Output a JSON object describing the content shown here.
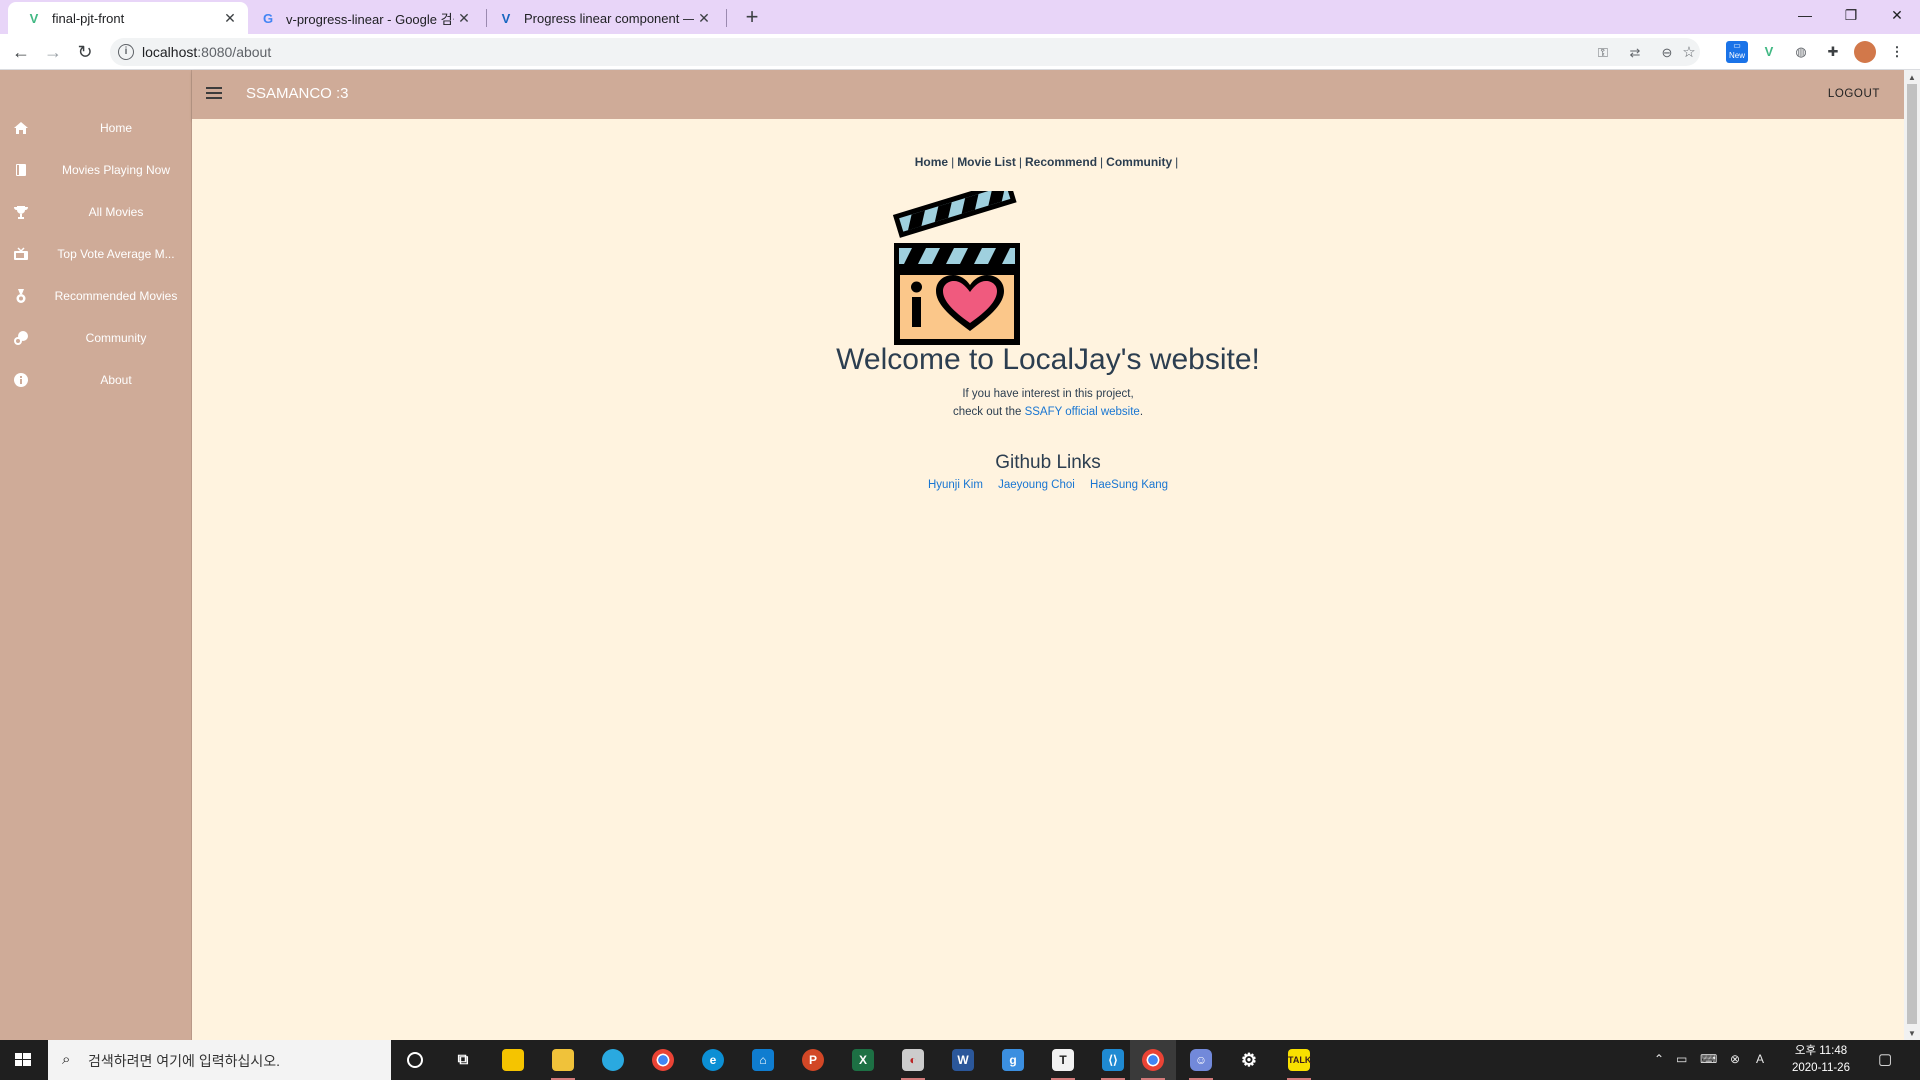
{
  "browser": {
    "tabs": [
      {
        "title": "final-pjt-front",
        "active": true
      },
      {
        "title": "v-progress-linear - Google 검색",
        "active": false
      },
      {
        "title": "Progress linear component — V",
        "active": false
      }
    ],
    "url_host": "localhost",
    "url_path": ":8080/about",
    "new_badge": "New"
  },
  "sidebar": {
    "items": [
      {
        "label": "Home",
        "icon": "home-icon"
      },
      {
        "label": "Movies Playing Now",
        "icon": "book-icon"
      },
      {
        "label": "All Movies",
        "icon": "trophy-icon"
      },
      {
        "label": "Top Vote Average M...",
        "icon": "tv-icon"
      },
      {
        "label": "Recommended Movies",
        "icon": "medal-icon"
      },
      {
        "label": "Community",
        "icon": "chat-icon"
      },
      {
        "label": "About",
        "icon": "info-icon"
      }
    ]
  },
  "appbar": {
    "title": "SSAMANCO :3",
    "logout": "LOGOUT"
  },
  "main": {
    "nav": [
      "Home",
      "Movie List",
      "Recommend",
      "Community"
    ],
    "nav_sep": "|",
    "welcome": "Welcome to LocalJay's website!",
    "para_line1": "If you have interest in this project,",
    "para_line2_prefix": "check out the ",
    "para_link": "SSAFY official website",
    "para_line2_suffix": ".",
    "github_title": "Github Links",
    "github_links": [
      "Hyunji Kim",
      "Jaeyoung Choi",
      "HaeSung Kang"
    ]
  },
  "taskbar": {
    "search_placeholder": "검색하려면 여기에 입력하십시오.",
    "time": "오후 11:48",
    "date": "2020-11-26",
    "ime": "A"
  },
  "colors": {
    "sidebar_bg": "#cfab98",
    "content_bg": "#fff3df",
    "link": "#1976d2",
    "text": "#2c3e50"
  }
}
